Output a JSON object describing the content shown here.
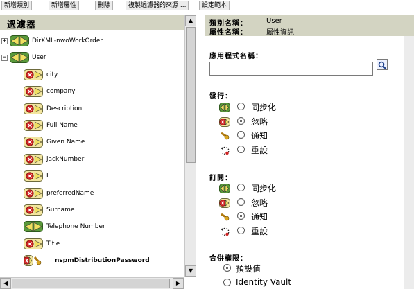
{
  "toolbar": {
    "buttons": [
      "新增類別",
      "新增屬性",
      "刪除",
      "複製過濾器的來源 ...",
      "設定範本"
    ]
  },
  "filter_panel": {
    "title": "過濾器",
    "tree": [
      {
        "label": "DirXML-nwoWorkOrder",
        "expander": "+",
        "type": "class",
        "icon": "sync-icon"
      },
      {
        "label": "User",
        "expander": "−",
        "type": "class",
        "icon": "sync-icon"
      },
      {
        "label": "city",
        "type": "attribute",
        "icon": "ignore-icon"
      },
      {
        "label": "company",
        "type": "attribute",
        "icon": "ignore-icon"
      },
      {
        "label": "Description",
        "type": "attribute",
        "icon": "ignore-icon"
      },
      {
        "label": "Full Name",
        "type": "attribute",
        "icon": "ignore-icon"
      },
      {
        "label": "Given Name",
        "type": "attribute",
        "icon": "ignore-icon"
      },
      {
        "label": "jackNumber",
        "type": "attribute",
        "icon": "ignore-icon"
      },
      {
        "label": "L",
        "type": "attribute",
        "icon": "ignore-icon"
      },
      {
        "label": "preferredName",
        "type": "attribute",
        "icon": "ignore-icon"
      },
      {
        "label": "Surname",
        "type": "attribute",
        "icon": "ignore-icon"
      },
      {
        "label": "Telephone Number",
        "type": "attribute",
        "icon": "sync-icon"
      },
      {
        "label": "Title",
        "type": "attribute",
        "icon": "ignore-icon"
      },
      {
        "label": "nspmDistributionPassword",
        "type": "attribute",
        "icon": "notify-icon",
        "bold": true
      }
    ]
  },
  "details_panel": {
    "class_name_label": "類別名稱：",
    "class_name_value": "User",
    "attr_name_label": "屬性名稱：",
    "attr_name_value": "屬性資訊",
    "app_name_label": "應用程式名稱：",
    "app_name_value": "",
    "publisher": {
      "label": "發行：",
      "options": [
        {
          "label": "同步化",
          "icon": "sync-icon",
          "checked": false
        },
        {
          "label": "忽略",
          "icon": "ignore-icon",
          "checked": true
        },
        {
          "label": "通知",
          "icon": "notify-icon",
          "checked": false
        },
        {
          "label": "重設",
          "icon": "reset-icon",
          "checked": false
        }
      ]
    },
    "subscriber": {
      "label": "訂閱：",
      "options": [
        {
          "label": "同步化",
          "icon": "sync-icon",
          "checked": false
        },
        {
          "label": "忽略",
          "icon": "ignore-icon",
          "checked": false
        },
        {
          "label": "通知",
          "icon": "notify-icon",
          "checked": true
        },
        {
          "label": "重設",
          "icon": "reset-icon",
          "checked": false
        }
      ]
    },
    "merge_authority": {
      "label": "合併權限：",
      "options": [
        {
          "label": "預設值",
          "checked": true
        },
        {
          "label": "Identity Vault",
          "checked": false
        }
      ]
    }
  },
  "colors": {
    "header_bg": "#d3d4c2",
    "sync_green": "#5a9a3a",
    "ignore_red": "#cc2222",
    "arrow_yellow": "#f0e060"
  }
}
